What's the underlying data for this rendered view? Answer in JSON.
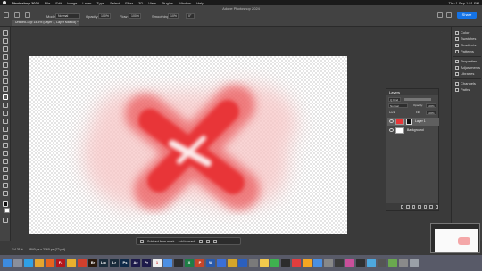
{
  "menubar": {
    "app": "Photoshop 2024",
    "items": [
      "File",
      "Edit",
      "Image",
      "Layer",
      "Type",
      "Select",
      "Filter",
      "3D",
      "View",
      "Plugins",
      "Window",
      "Help"
    ],
    "clock": "Thu 1 Sep  1:51 PM"
  },
  "window_title": "Adobe Photoshop 2024",
  "options": {
    "mode_label": "Mode:",
    "mode_value": "Normal",
    "opacity_label": "Opacity:",
    "opacity_value": "100%",
    "flow_label": "Flow:",
    "flow_value": "100%",
    "smoothing_label": "Smoothing:",
    "smoothing_value": "10%",
    "angle_value": "0°",
    "share_label": "Share"
  },
  "document_tab": "Untitled-1 @ 14.3% (Layer 1, Layer Mask/8) *",
  "canvas": {
    "stroke_color": "#e83638",
    "haze_color": "#f8c6c6"
  },
  "taskbar": {
    "subtract_label": "Subtract from mask",
    "add_label": "Add to mask"
  },
  "status": {
    "zoom": "14.31%",
    "doc_size": "3840 px x 2160 px (72 ppi)"
  },
  "right_panels": [
    "Color",
    "Swatches",
    "Gradients",
    "Patterns",
    "Properties",
    "Adjustments",
    "Libraries",
    "Channels",
    "Paths"
  ],
  "layers_panel": {
    "title": "Layers",
    "kind_label": "Q Kind",
    "blend_mode": "Normal",
    "opacity_label": "Opacity:",
    "opacity_value": "100%",
    "lock_label": "Lock:",
    "fill_label": "Fill:",
    "fill_value": "100%",
    "layers": [
      {
        "name": "Layer 1",
        "selected": true
      },
      {
        "name": "Background",
        "selected": false
      }
    ]
  },
  "dock": [
    {
      "name": "finder-icon",
      "color": "#3d8be0",
      "glyph": ""
    },
    {
      "name": "launchpad-icon",
      "color": "#8a8f9c",
      "glyph": ""
    },
    {
      "name": "safari-icon",
      "color": "#2fa0e6",
      "glyph": ""
    },
    {
      "name": "chrome-icon",
      "color": "#e6a62f",
      "glyph": ""
    },
    {
      "name": "firefox-icon",
      "color": "#e8641e",
      "glyph": ""
    },
    {
      "name": "filezilla-icon",
      "color": "#b5161c",
      "glyph": "Fz"
    },
    {
      "name": "app-icon",
      "color": "#e8b02e",
      "glyph": ""
    },
    {
      "name": "app-icon-2",
      "color": "#d0402d",
      "glyph": ""
    },
    {
      "name": "bridge-icon",
      "color": "#2a1a0e",
      "glyph": "Br"
    },
    {
      "name": "lightroom-classic-icon",
      "color": "#1a2b3a",
      "glyph": "Lrc"
    },
    {
      "name": "lightroom-icon",
      "color": "#1a2b3a",
      "glyph": "Lr"
    },
    {
      "name": "photoshop-icon",
      "color": "#0f2a48",
      "glyph": "Ps"
    },
    {
      "name": "after-effects-icon",
      "color": "#1d1a4a",
      "glyph": "Ae"
    },
    {
      "name": "premiere-icon",
      "color": "#1d1a4a",
      "glyph": "Pr"
    },
    {
      "name": "calendar-icon",
      "color": "#f0f0f0",
      "glyph": "1"
    },
    {
      "name": "app-icon-3",
      "color": "#4c8fe4",
      "glyph": ""
    },
    {
      "name": "app-icon-4",
      "color": "#2c2c2c",
      "glyph": ""
    },
    {
      "name": "excel-icon",
      "color": "#1e7d45",
      "glyph": "X"
    },
    {
      "name": "powerpoint-icon",
      "color": "#c4462a",
      "glyph": "P"
    },
    {
      "name": "word-icon",
      "color": "#2a5aab",
      "glyph": "W"
    },
    {
      "name": "app-icon-5",
      "color": "#3a6fd8",
      "glyph": ""
    },
    {
      "name": "app-icon-6",
      "color": "#d4a52a",
      "glyph": ""
    },
    {
      "name": "app-icon-7",
      "color": "#2b5fbd",
      "glyph": ""
    },
    {
      "name": "app-icon-8",
      "color": "#7a7a7a",
      "glyph": ""
    },
    {
      "name": "app-icon-9",
      "color": "#f2c94c",
      "glyph": ""
    },
    {
      "name": "app-icon-10",
      "color": "#3fb24f",
      "glyph": ""
    },
    {
      "name": "app-icon-11",
      "color": "#2c2c2c",
      "glyph": ""
    },
    {
      "name": "app-icon-12",
      "color": "#e33d3d",
      "glyph": ""
    },
    {
      "name": "app-icon-13",
      "color": "#f5a623",
      "glyph": ""
    },
    {
      "name": "app-icon-14",
      "color": "#4a90e2",
      "glyph": ""
    },
    {
      "name": "app-icon-15",
      "color": "#888888",
      "glyph": ""
    },
    {
      "name": "app-icon-16",
      "color": "#3a3a3a",
      "glyph": ""
    },
    {
      "name": "app-icon-17",
      "color": "#c94f9a",
      "glyph": ""
    },
    {
      "name": "app-icon-18",
      "color": "#2f2f2f",
      "glyph": ""
    },
    {
      "name": "app-icon-19",
      "color": "#4ea8de",
      "glyph": ""
    },
    {
      "name": "app-icon-20",
      "color": "#555555",
      "glyph": ""
    },
    {
      "name": "app-icon-21",
      "color": "#6aa84f",
      "glyph": ""
    },
    {
      "name": "app-icon-22",
      "color": "#8a8a8a",
      "glyph": ""
    },
    {
      "name": "trash-icon",
      "color": "#9aa0a8",
      "glyph": ""
    }
  ]
}
